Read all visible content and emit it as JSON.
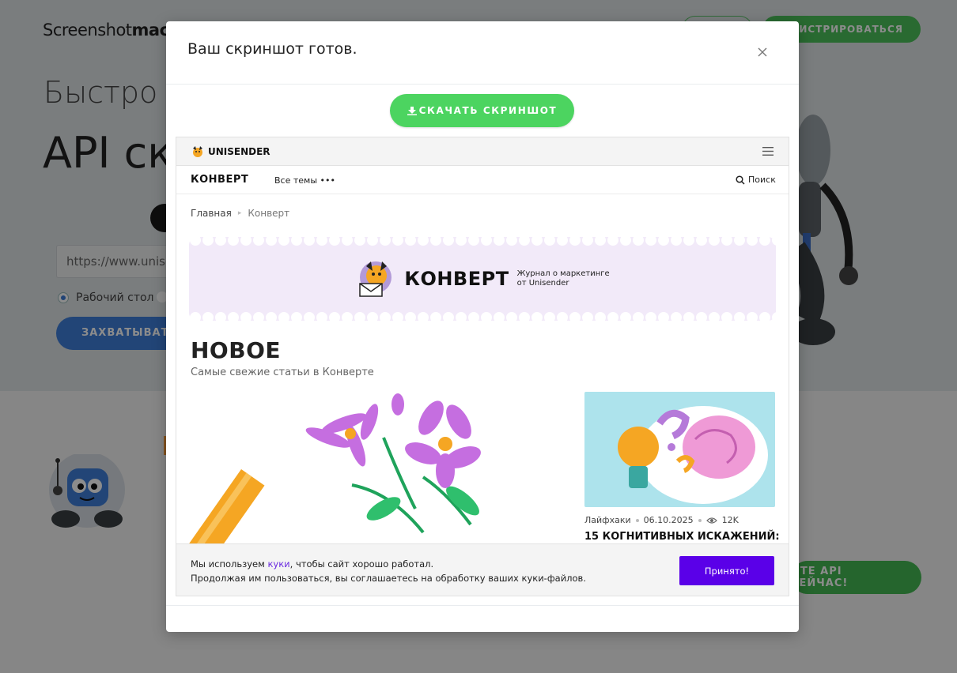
{
  "background": {
    "logo_light": "Screenshot",
    "logo_bold": "machin",
    "register_label": "ЕГИСТРИРОВАТЬСЯ",
    "headline_small": "Быстро и",
    "headline_big": "API скр",
    "url_value": "https://www.unisen",
    "radio_label": "Рабочий стол",
    "capture_label": "ЗАХВАТЫВАТ",
    "try_label": "ЙТЕ API СЕЙЧАС!"
  },
  "modal": {
    "title": "Ваш скриншот готов.",
    "download_label": "СКАЧАТЬ СКРИНШОТ"
  },
  "preview": {
    "brand": "UNISENDER",
    "section_logo": "КОНВЕРТ",
    "topics_label": "Все темы",
    "search_label": "Поиск",
    "breadcrumbs": [
      "Главная",
      "Конверт"
    ],
    "banner_title": "КОНВЕРТ",
    "banner_sub_line1": "Журнал о маркетинге",
    "banner_sub_line2": "от Unisender",
    "new_title": "НОВОЕ",
    "new_subtitle": "Самые свежие статьи в Конверте",
    "card": {
      "category": "Лайфхаки",
      "date": "06.10.2025",
      "views": "12K",
      "title": "15 КОГНИТИВНЫХ ИСКАЖЕНИЙ:"
    },
    "cookie": {
      "text_before": "Мы используем ",
      "link": "куки",
      "text_after": ", чтобы сайт хорошо работал.",
      "line2": "Продолжая им пользоваться, вы соглашаетесь на обработку ваших куки-файлов.",
      "accept_label": "Принято!"
    }
  },
  "colors": {
    "download_green": "#4cd460",
    "accept_purple": "#5a00e8",
    "capture_blue": "#3f7fd9"
  }
}
